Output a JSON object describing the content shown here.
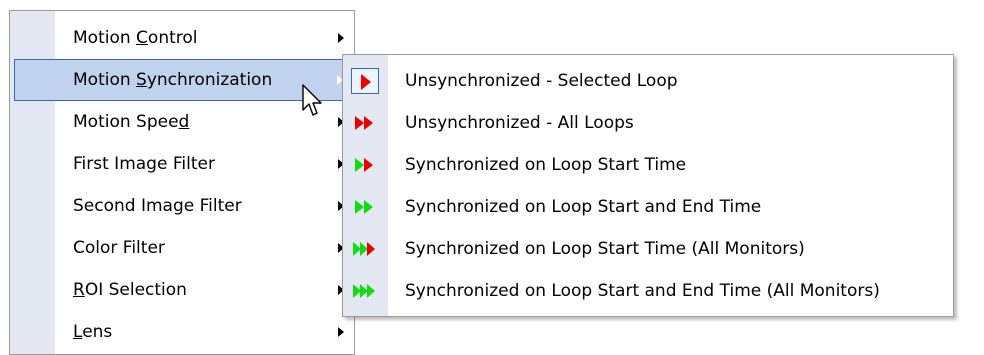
{
  "main_menu": {
    "items": [
      {
        "pre": "Motion ",
        "u": "C",
        "post": "ontrol"
      },
      {
        "pre": "Motion ",
        "u": "S",
        "post": "ynchronization"
      },
      {
        "pre": "Motion Spee",
        "u": "d",
        "post": ""
      },
      {
        "pre": "First Image Filter",
        "u": "",
        "post": ""
      },
      {
        "pre": "Second Image Filter",
        "u": "",
        "post": ""
      },
      {
        "pre": "Color Filter",
        "u": "",
        "post": ""
      },
      {
        "pre": "",
        "u": "R",
        "post": "OI Selection"
      },
      {
        "pre": "",
        "u": "L",
        "post": "ens"
      }
    ]
  },
  "sub_menu": {
    "items": [
      {
        "label": "Unsynchronized - Selected Loop",
        "icon": "single-red-play-icon"
      },
      {
        "label": "Unsynchronized - All Loops",
        "icon": "double-red-play-icon"
      },
      {
        "label": "Synchronized on Loop Start Time",
        "icon": "green-red-play-icon"
      },
      {
        "label": "Synchronized on Loop Start and End Time",
        "icon": "double-green-play-icon"
      },
      {
        "label": "Synchronized on Loop Start Time (All Monitors)",
        "icon": "triple-green-red-play-icon"
      },
      {
        "label": "Synchronized on Loop Start and End Time (All Monitors)",
        "icon": "triple-green-play-icon"
      }
    ]
  },
  "colors": {
    "gutter": "#e3e8f3",
    "highlight_fill": "#c1d2ee",
    "highlight_border": "#316ac5",
    "red": "#ee0000",
    "green": "#11dd11"
  }
}
